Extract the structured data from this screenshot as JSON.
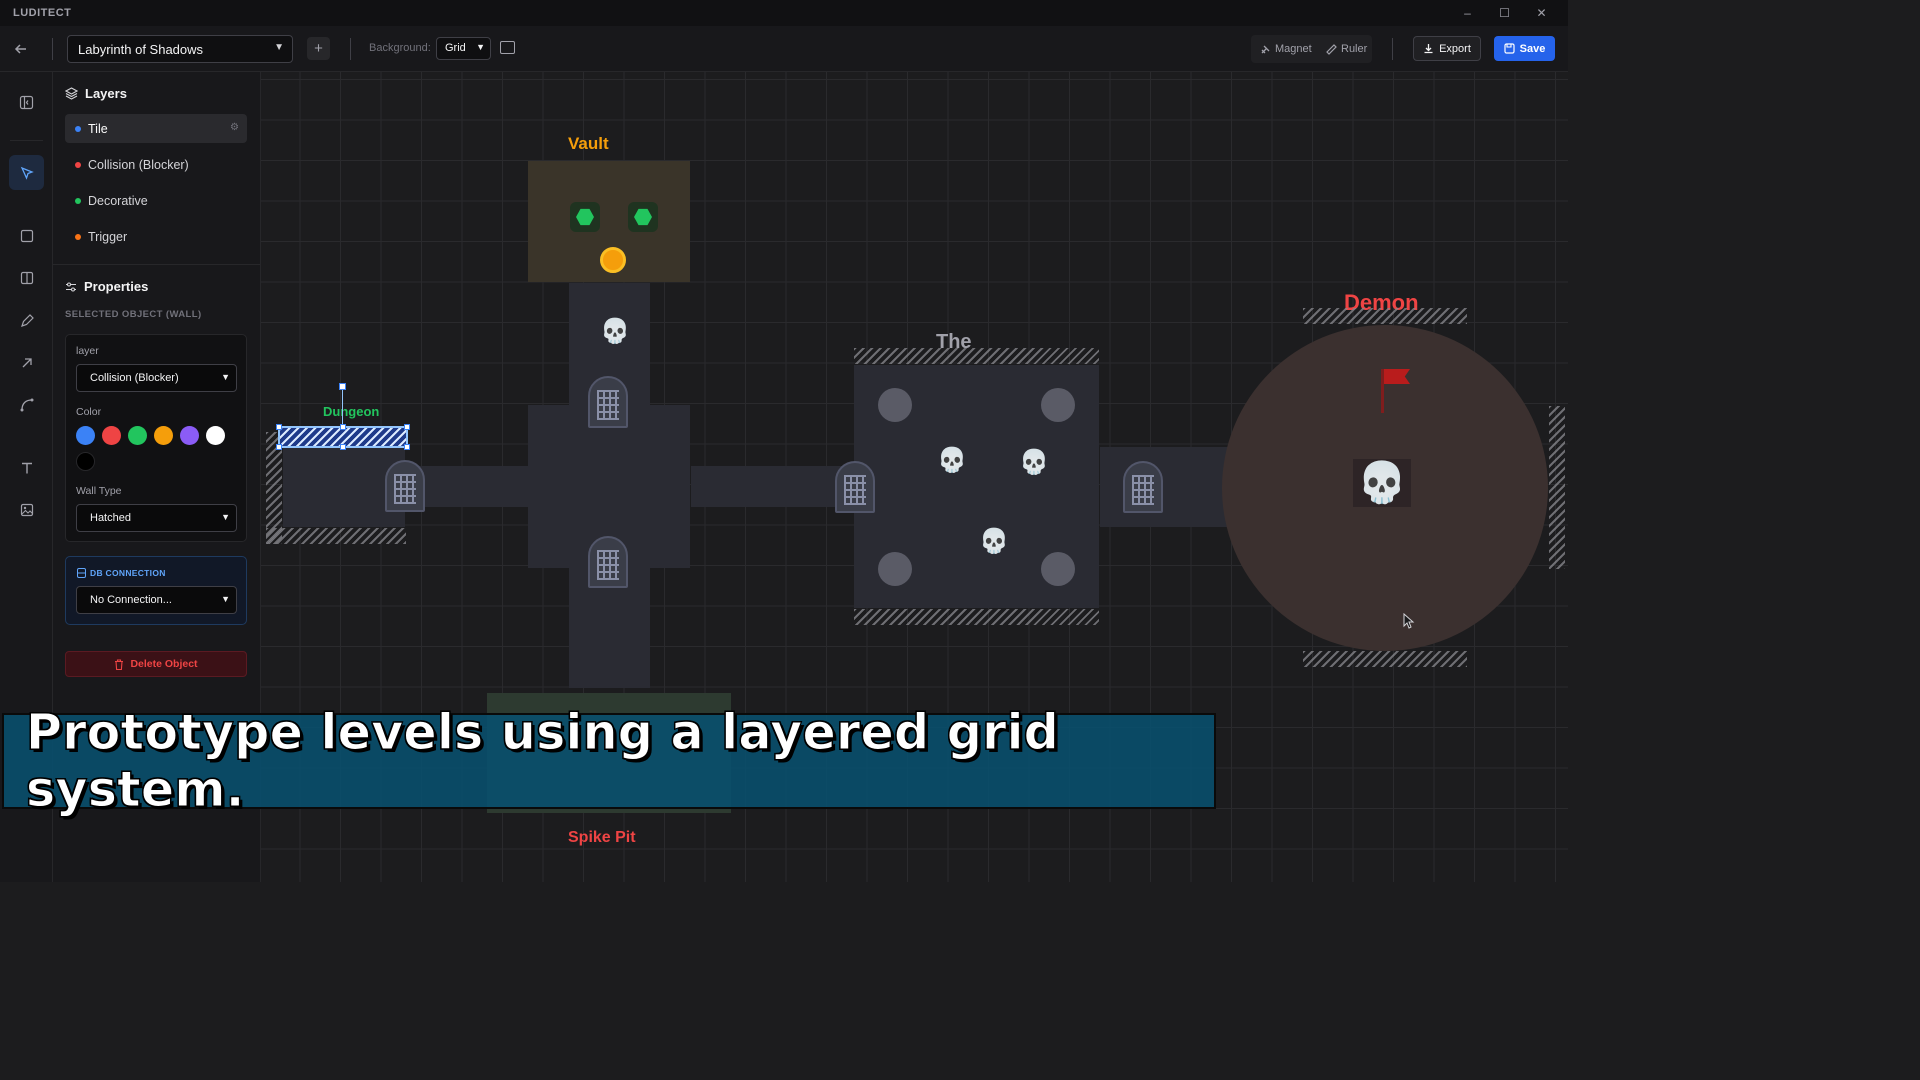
{
  "app": {
    "name": "LUDITECT"
  },
  "window_controls": {
    "minimize": "–",
    "maximize": "☐",
    "close": "✕"
  },
  "toolbar": {
    "project": "Labyrinth of Shadows",
    "add": "+",
    "background_label": "Background:",
    "background_value": "Grid",
    "magnet": "Magnet",
    "ruler": "Ruler",
    "export": "Export",
    "save": "Save"
  },
  "rail": {
    "tools": [
      "panel-toggle",
      "select",
      "rectangle",
      "split-view",
      "pen",
      "arrow",
      "curve",
      "text",
      "image"
    ]
  },
  "layers": {
    "title": "Layers",
    "items": [
      {
        "label": "Tile",
        "color": "#3b82f6"
      },
      {
        "label": "Collision (Blocker)",
        "color": "#ef4444"
      },
      {
        "label": "Decorative",
        "color": "#22c55e"
      },
      {
        "label": "Trigger",
        "color": "#f97316"
      }
    ]
  },
  "properties": {
    "title": "Properties",
    "selected": "SELECTED OBJECT (WALL)",
    "layer_label": "layer",
    "layer_value": "Collision (Blocker)",
    "color_label": "Color",
    "colors": [
      "#3b82f6",
      "#ef4444",
      "#22c55e",
      "#f59e0b",
      "#8b5cf6",
      "#ffffff",
      "#000000"
    ],
    "wall_type_label": "Wall Type",
    "wall_type_value": "Hatched",
    "db_title": "DB CONNECTION",
    "db_value": "No Connection...",
    "delete": "Delete Object"
  },
  "map": {
    "rooms": {
      "vault": {
        "label": "Vault",
        "color": "#f59e0b"
      },
      "dungeon": {
        "label": "Dungeon",
        "color": "#22c55e"
      },
      "the": {
        "label": "The",
        "color": "#a1a1aa"
      },
      "demon": {
        "label": "Demon",
        "color": "#ef4444"
      },
      "spike": {
        "label": "Spike Pit",
        "color": "#ef4444"
      }
    }
  },
  "caption": "Prototype levels using a layered grid system."
}
